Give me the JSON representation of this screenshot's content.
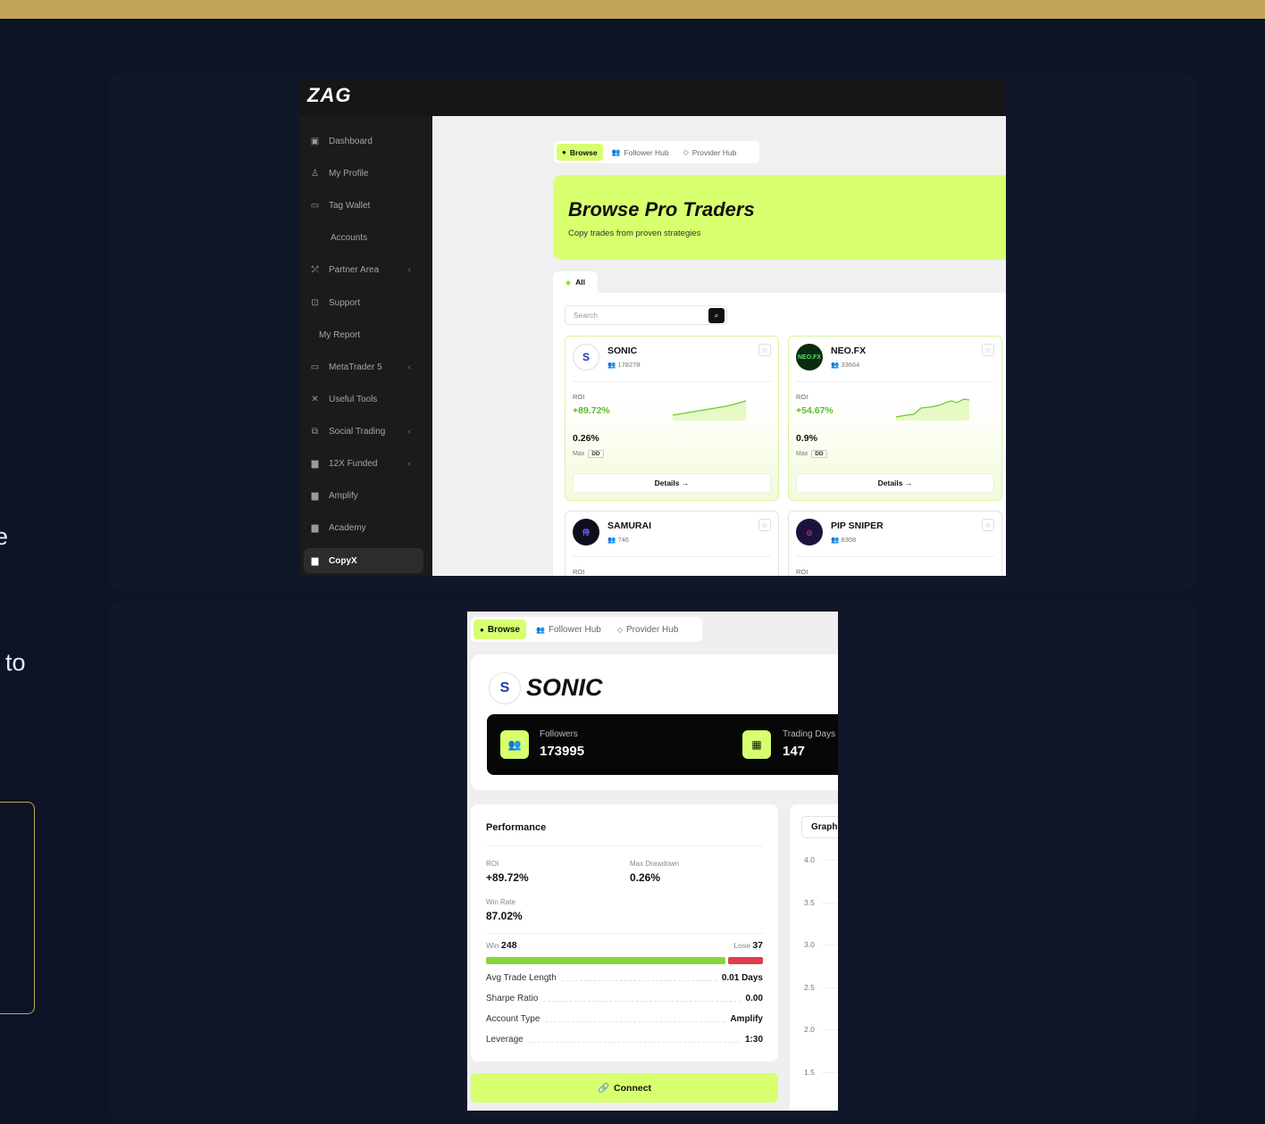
{
  "page": {
    "edge_text_1": "e",
    "edge_text_2": "to"
  },
  "colors": {
    "accent": "#d8ff6e",
    "background": "#0d1426",
    "gold": "#c4a45a",
    "roi_green": "#5fb82a",
    "win_green": "#86d63a",
    "lose_red": "#e33b4d"
  },
  "app": {
    "logo": "ZAG",
    "sidebar": {
      "items": [
        {
          "label": "Dashboard",
          "icon": "dashboard-icon"
        },
        {
          "label": "My Profile",
          "icon": "user-icon"
        },
        {
          "label": "Tag Wallet",
          "icon": "wallet-icon"
        },
        {
          "label": "Accounts",
          "icon": ""
        },
        {
          "label": "Partner Area",
          "icon": "network-icon"
        },
        {
          "label": "Support",
          "icon": "ticket-icon"
        },
        {
          "label": "My Report",
          "icon": ""
        },
        {
          "label": "MetaTrader 5",
          "icon": "laptop-icon"
        },
        {
          "label": "Useful Tools",
          "icon": "tools-icon"
        },
        {
          "label": "Social Trading",
          "icon": "copy-icon"
        },
        {
          "label": "12X Funded",
          "icon": "bar-chart-icon"
        },
        {
          "label": "Amplify",
          "icon": "bar-chart-icon"
        },
        {
          "label": "Academy",
          "icon": "bar-chart-icon"
        },
        {
          "label": "CopyX",
          "icon": "bar-chart-icon"
        }
      ],
      "active": "CopyX"
    },
    "tabs": {
      "browse": "Browse",
      "follower_hub": "Follower Hub",
      "provider_hub": "Provider Hub"
    },
    "hero": {
      "title": "Browse Pro Traders",
      "subtitle": "Copy trades from proven strategies"
    },
    "filter": {
      "all": "All"
    },
    "search": {
      "placeholder": "Search"
    },
    "cards": [
      {
        "name": "SONIC",
        "followers": "178278",
        "roi_label": "ROI",
        "roi": "+89.72%",
        "drawdown": "0.26%",
        "max_label": "Max",
        "dd_badge": "DD",
        "details": "Details"
      },
      {
        "name": "NEO.FX",
        "followers": "33664",
        "roi_label": "ROI",
        "roi": "+54.67%",
        "drawdown": "0.9%",
        "max_label": "Max",
        "dd_badge": "DD",
        "details": "Details",
        "avatar_text": "NEO.FX"
      },
      {
        "name": "SAMURAI",
        "followers": "746",
        "roi_label": "ROI"
      },
      {
        "name": "PIP SNIPER",
        "followers": "8308",
        "roi_label": "ROI"
      }
    ]
  },
  "detail": {
    "tabs": {
      "browse": "Browse",
      "follower_hub": "Follower Hub",
      "provider_hub": "Provider Hub"
    },
    "title": "SONIC",
    "stats": {
      "followers_label": "Followers",
      "followers_value": "173995",
      "trading_days_label": "Trading Days",
      "trading_days_value": "147"
    },
    "performance": {
      "heading": "Performance",
      "roi_label": "ROI",
      "roi_value": "+89.72%",
      "max_dd_label": "Max Drawdown",
      "max_dd_value": "0.26%",
      "win_rate_label": "Win Rate",
      "win_rate_value": "87.02%",
      "win_label": "Win",
      "win_value": "248",
      "lose_label": "Lose",
      "lose_value": "37",
      "rows": [
        {
          "label": "Avg Trade Length",
          "value": "0.01 Days"
        },
        {
          "label": "Sharpe Ratio",
          "value": "0.00"
        },
        {
          "label": "Account Type",
          "value": "Amplify"
        },
        {
          "label": "Leverage",
          "value": "1:30"
        }
      ]
    },
    "connect": "Connect",
    "graph": {
      "tab": "Graph",
      "ticks": [
        "4.0",
        "3.5",
        "3.0",
        "2.5",
        "2.0",
        "1.5"
      ]
    }
  }
}
